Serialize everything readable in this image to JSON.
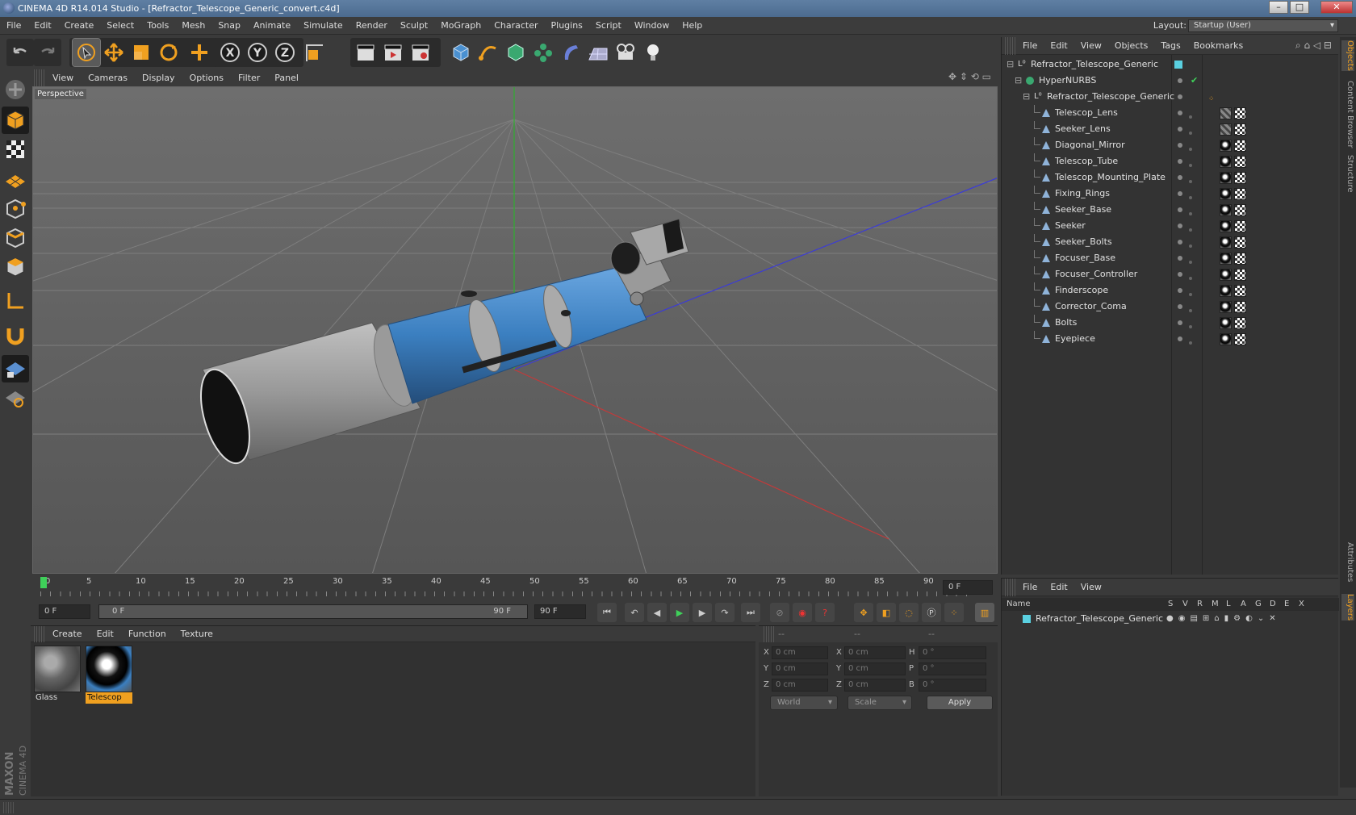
{
  "window": {
    "title": "CINEMA 4D R14.014 Studio - [Refractor_Telescope_Generic_convert.c4d]",
    "minimize": "–",
    "maximize": "□",
    "close": "✕"
  },
  "menubar": {
    "items": [
      "File",
      "Edit",
      "Create",
      "Select",
      "Tools",
      "Mesh",
      "Snap",
      "Animate",
      "Simulate",
      "Render",
      "Sculpt",
      "MoGraph",
      "Character",
      "Plugins",
      "Script",
      "Window",
      "Help"
    ],
    "layout_label": "Layout:",
    "layout_value": "Startup (User)"
  },
  "viewport": {
    "menu": [
      "View",
      "Cameras",
      "Display",
      "Options",
      "Filter",
      "Panel"
    ],
    "label": "Perspective",
    "axis_y": "y",
    "axis_x": "x",
    "axis_z": "z"
  },
  "timeline": {
    "ticks": [
      "0",
      "5",
      "10",
      "15",
      "20",
      "25",
      "30",
      "35",
      "40",
      "45",
      "50",
      "55",
      "60",
      "65",
      "70",
      "75",
      "80",
      "85",
      "90"
    ],
    "current": "0 F",
    "current_frame_fraction": 0.0
  },
  "transport": {
    "start": "0 F",
    "range_start": "0 F",
    "range_end": "90 F",
    "end": "90 F"
  },
  "materials": {
    "menu": [
      "Create",
      "Edit",
      "Function",
      "Texture"
    ],
    "items": [
      {
        "name": "Glass",
        "selected": false
      },
      {
        "name": "Telescop",
        "selected": true
      }
    ]
  },
  "coords": {
    "header": [
      "--",
      "--",
      "--"
    ],
    "rows": [
      {
        "l1": "X",
        "v1": "0 cm",
        "l2": "X",
        "v2": "0 cm",
        "l3": "H",
        "v3": "0 °"
      },
      {
        "l1": "Y",
        "v1": "0 cm",
        "l2": "Y",
        "v2": "0 cm",
        "l3": "P",
        "v3": "0 °"
      },
      {
        "l1": "Z",
        "v1": "0 cm",
        "l2": "Z",
        "v2": "0 cm",
        "l3": "B",
        "v3": "0 °"
      }
    ],
    "world": "World",
    "scale": "Scale",
    "apply": "Apply"
  },
  "objects": {
    "menu": [
      "File",
      "Edit",
      "View",
      "Objects",
      "Tags",
      "Bookmarks"
    ],
    "root": "Refractor_Telescope_Generic",
    "hypernurbs": "HyperNURBS",
    "group": "Refractor_Telescope_Generic",
    "children": [
      {
        "name": "Telescop_Lens",
        "tag": "glass"
      },
      {
        "name": "Seeker_Lens",
        "tag": "glass"
      },
      {
        "name": "Diagonal_Mirror",
        "tag": "ball"
      },
      {
        "name": "Telescop_Tube",
        "tag": "ball"
      },
      {
        "name": "Telescop_Mounting_Plate",
        "tag": "ball"
      },
      {
        "name": "Fixing_Rings",
        "tag": "ball"
      },
      {
        "name": "Seeker_Base",
        "tag": "ball"
      },
      {
        "name": "Seeker",
        "tag": "ball"
      },
      {
        "name": "Seeker_Bolts",
        "tag": "ball"
      },
      {
        "name": "Focuser_Base",
        "tag": "ball"
      },
      {
        "name": "Focuser_Controller",
        "tag": "ball"
      },
      {
        "name": "Finderscope",
        "tag": "ball"
      },
      {
        "name": "Corrector_Coma",
        "tag": "ball"
      },
      {
        "name": "Bolts",
        "tag": "ball"
      },
      {
        "name": "Eyepiece",
        "tag": "ball"
      }
    ]
  },
  "layers": {
    "menu": [
      "File",
      "Edit",
      "View"
    ],
    "cols": {
      "name": "Name",
      "flags": [
        "S",
        "V",
        "R",
        "M",
        "L",
        "A",
        "G",
        "D",
        "E",
        "X"
      ]
    },
    "row": "Refractor_Telescope_Generic"
  },
  "sidetabs": [
    "Objects",
    "Content Browser",
    "Structure",
    "Attributes",
    "Layers"
  ],
  "brand": {
    "maxon": "MAXON",
    "c4d": "CINEMA 4D"
  },
  "colors": {
    "accent": "#f0a020",
    "selection": "#5ad0e0",
    "tube": "#3b7fc0"
  }
}
